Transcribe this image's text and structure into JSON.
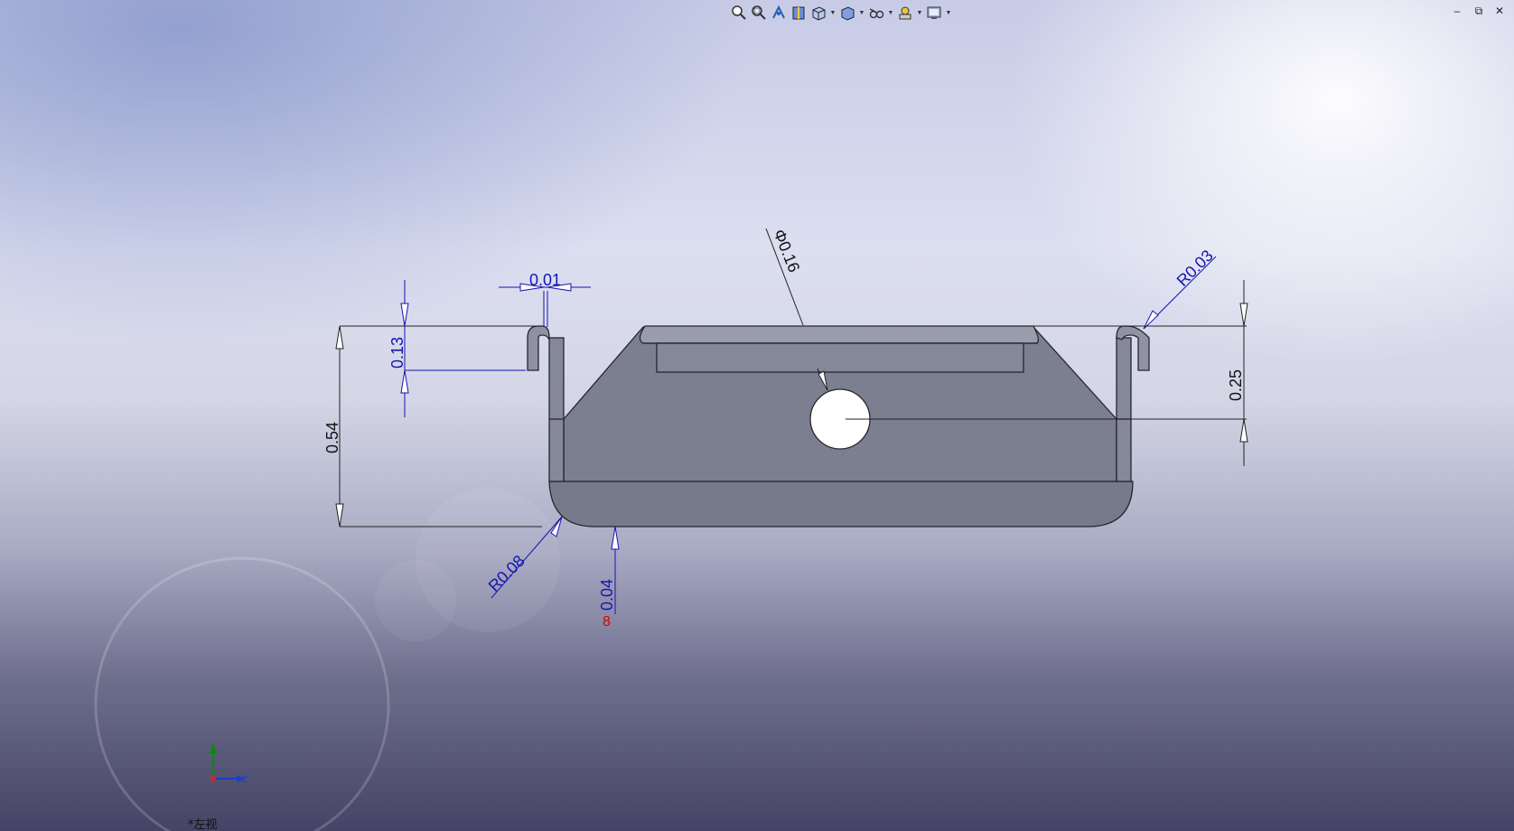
{
  "toolbar": {
    "icons": [
      "zoom-to-fit-icon",
      "zoom-to-area-icon",
      "previous-view-icon",
      "section-view-icon",
      "view-orientation-icon",
      "display-style-icon",
      "hide-show-items-icon",
      "edit-appearance-icon",
      "apply-scene-icon"
    ]
  },
  "window_controls": {
    "minimize": "–",
    "restore": "⧉",
    "close": "✕"
  },
  "view": {
    "label": "*左视"
  },
  "axis_triad": {
    "y": "Y",
    "z": "Z"
  },
  "dimensions": {
    "width_top_gap": "0.01",
    "left_hook_height": "0.13",
    "overall_height": "0.54",
    "hole_diameter": "Φ0.16",
    "right_bend_radius": "R0.03",
    "hole_height": "0.25",
    "bottom_bend_radius": "R0.08",
    "thickness": "0.04",
    "thickness_suffix": "8"
  },
  "colors": {
    "dimension": "#1414b4",
    "part_face": "#7c7f90",
    "part_edge": "#25262e",
    "error": "#e00000"
  }
}
